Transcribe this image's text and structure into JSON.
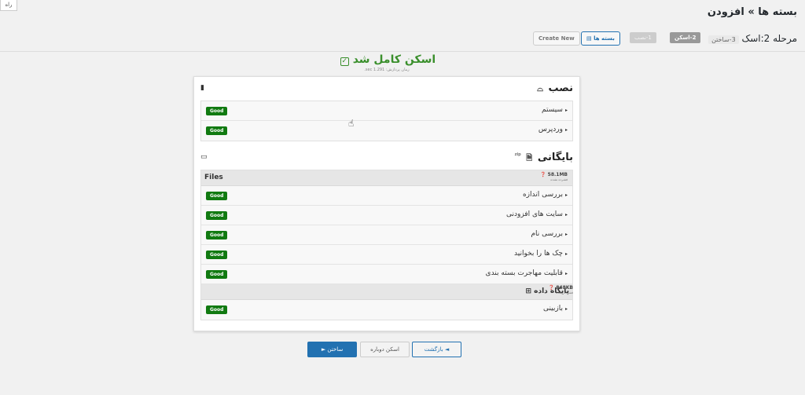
{
  "help_tab": "راه",
  "page_title": "بسته ها » افزودن",
  "steps": {
    "label_prefix": "مرحله 2:اسک",
    "label_step3": "3-ساختن",
    "step2": "2-اسکن",
    "step1": "1-نصب",
    "packages_button": "بسته ها",
    "create_new_button": "Create New"
  },
  "scan": {
    "title": "اسکن کامل شد",
    "time": "زمان پردازش: 1.291 sec."
  },
  "install_section": {
    "title": "نصب",
    "rows": [
      {
        "label": "سیستم",
        "status": "Good"
      },
      {
        "label": "وردپرس",
        "status": "Good"
      }
    ]
  },
  "archive_section": {
    "title": "بایگانی",
    "sup": "zip",
    "files": {
      "title": "Files",
      "size": "58.1MB",
      "size_note": "فشرده نشده"
    },
    "rows": [
      {
        "label": "بررسی اندازه",
        "status": "Good"
      },
      {
        "label": "سایت های افزودنی",
        "status": "Good"
      },
      {
        "label": "بررسی نام",
        "status": "Good"
      },
      {
        "label": "چک ها را بخوانید",
        "status": "Good"
      },
      {
        "label": "قابلیت مهاجرت بسته بندی",
        "status": "Good"
      }
    ],
    "database": {
      "title": "پایگاه داده",
      "size": "848KB",
      "size_note": "فشرده نشده"
    },
    "db_rows": [
      {
        "label": "بازبینی",
        "status": "Good"
      }
    ]
  },
  "footer": {
    "build": "ساختن ►",
    "rescan": "اسکن دوباره",
    "back": "◄ بازگشت"
  }
}
